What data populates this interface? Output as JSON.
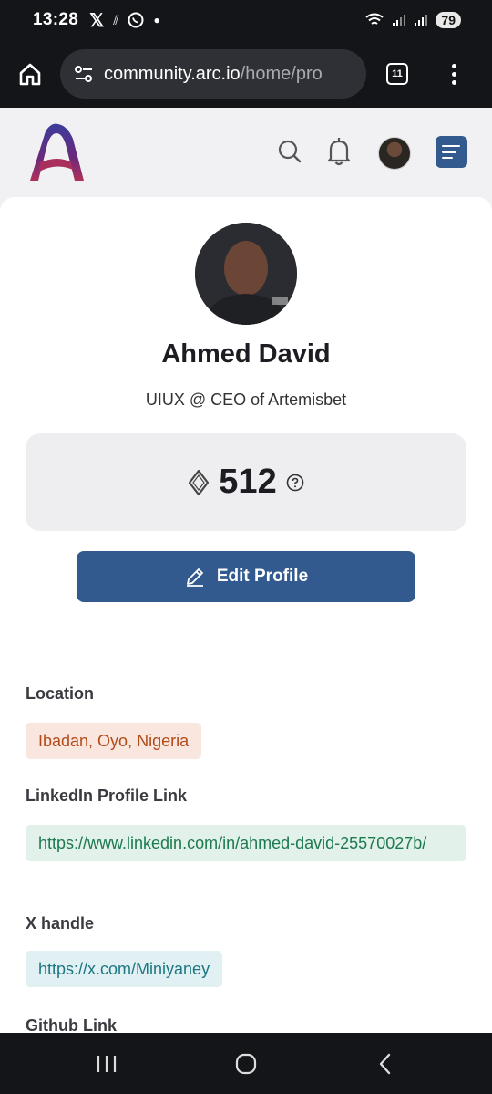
{
  "status_bar": {
    "time": "13:28",
    "battery": "79"
  },
  "browser": {
    "url_domain": "community.arc.io",
    "url_path": "/home/pro",
    "tab_count": "11"
  },
  "profile": {
    "name": "Ahmed David",
    "title": "UIUX @ CEO of Artemisbet",
    "points": "512",
    "edit_label": "Edit Profile"
  },
  "fields": {
    "location_label": "Location",
    "location_value": "Ibadan, Oyo, Nigeria",
    "linkedin_label": "LinkedIn Profile Link",
    "linkedin_value": "https://www.linkedin.com/in/ahmed-david-25570027b/",
    "x_label": "X handle",
    "x_value": "https://x.com/Miniyaney",
    "github_label": "Github Link"
  },
  "colors": {
    "brand_blue": "#325a8f",
    "location_chip_bg": "#f9e7df",
    "location_chip_text": "#b34a1a",
    "linkedin_chip_bg": "#e2f1ea",
    "linkedin_chip_text": "#1d7a4f",
    "x_chip_bg": "#e1f1f3",
    "x_chip_text": "#1e7683"
  },
  "icons": {
    "home": "home-icon",
    "site_settings": "site-settings-icon",
    "more": "more-vert-icon",
    "search": "search-icon",
    "bell": "bell-icon",
    "menu": "menu-icon",
    "diamond": "diamond-icon",
    "help": "help-circle-icon",
    "pencil": "pencil-icon"
  }
}
